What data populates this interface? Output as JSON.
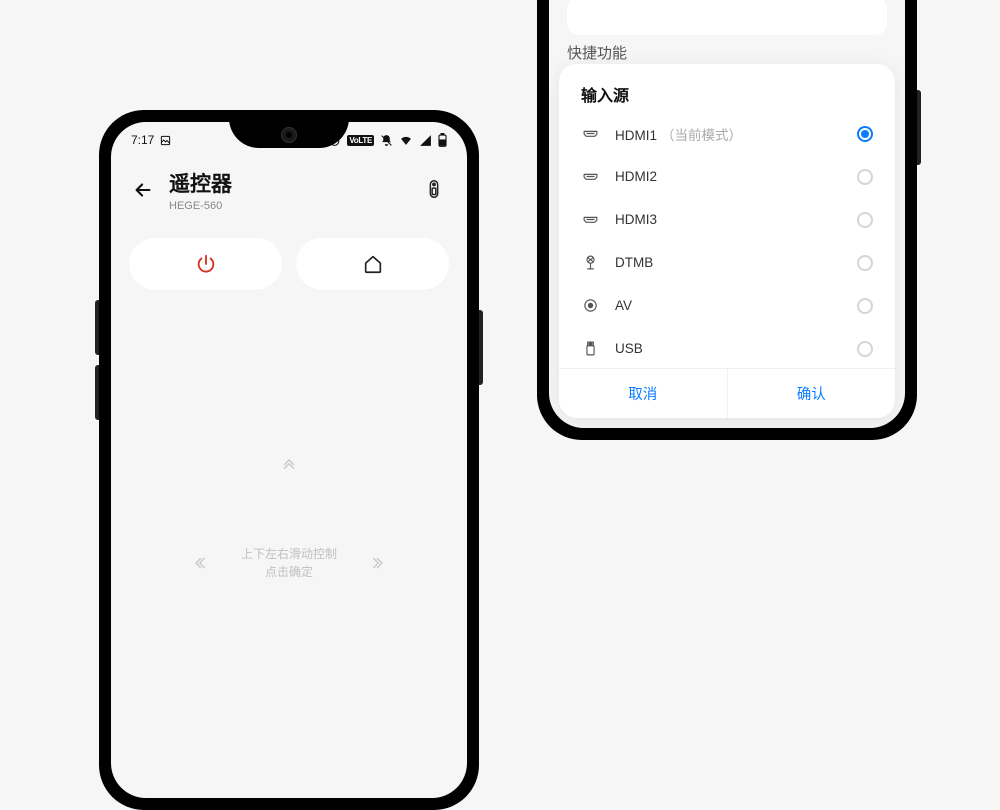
{
  "left": {
    "status_time": "7:17",
    "status_volte": "VoLTE",
    "title": "遥控器",
    "subtitle": "HEGE-560",
    "hint_line1": "上下左右滑动控制",
    "hint_line2": "点击确定"
  },
  "right": {
    "shortcut_label": "快捷功能",
    "sheet_title": "输入源",
    "sources": [
      {
        "label": "HDMI1",
        "suffix": "（当前模式）",
        "icon": "hdmi",
        "selected": true
      },
      {
        "label": "HDMI2",
        "suffix": "",
        "icon": "hdmi",
        "selected": false
      },
      {
        "label": "HDMI3",
        "suffix": "",
        "icon": "hdmi",
        "selected": false
      },
      {
        "label": "DTMB",
        "suffix": "",
        "icon": "antenna",
        "selected": false
      },
      {
        "label": "AV",
        "suffix": "",
        "icon": "av",
        "selected": false
      },
      {
        "label": "USB",
        "suffix": "",
        "icon": "usb",
        "selected": false
      }
    ],
    "cancel": "取消",
    "confirm": "确认"
  },
  "colors": {
    "accent": "#0a7cff",
    "power": "#d93025"
  }
}
